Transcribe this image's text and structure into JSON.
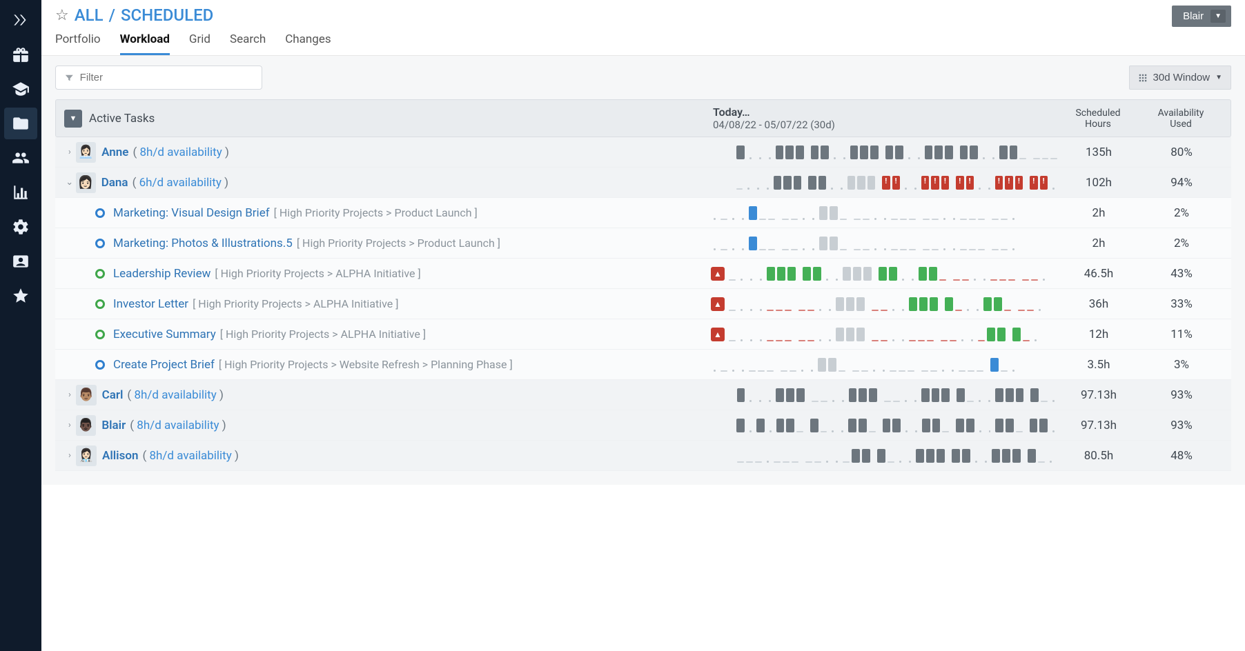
{
  "user": {
    "name": "Blair"
  },
  "breadcrumb": {
    "root": "ALL",
    "leaf": "SCHEDULED"
  },
  "tabs": [
    "Portfolio",
    "Workload",
    "Grid",
    "Search",
    "Changes"
  ],
  "activeTab": "Workload",
  "filter_placeholder": "Filter",
  "window_label": "30d Window",
  "header": {
    "tasks": "Active Tasks",
    "today": "Today…",
    "range": "04/08/22 - 05/07/22 (30d)",
    "hours_top": "Scheduled",
    "hours_bot": "Hours",
    "avail_top": "Availability",
    "avail_bot": "Used"
  },
  "people": [
    {
      "name": "Anne",
      "avail": "8h/d availability",
      "hours": "135h",
      "used": "80%",
      "expanded": false,
      "emoji": "👩🏻‍💼",
      "cells": "G . . . G G G G G . . G G G G G . . G G G G G . . G G _ _ _ _"
    },
    {
      "name": "Dana",
      "avail": "6h/d availability",
      "hours": "102h",
      "used": "94%",
      "expanded": true,
      "emoji": "👩🏻",
      "cells": "_ . . . G G G G G . . L L L R! R! . . R! R! R! R! R! . . R! R! R! R! R! .",
      "tasks": [
        {
          "name": "Marketing: Visual Design Brief",
          "path": "[ High Priority Projects > Product Launch ]",
          "color": "blue",
          "alert": false,
          "hours": "2h",
          "used": "2%",
          "cells": ": _ . . B _ _ _ _ . . L L _ _ _ . . _ _ _ _ _ . . _ _ _ _ _ ."
        },
        {
          "name": "Marketing: Photos & Illustrations.5",
          "path": "[ High Priority Projects > Product Launch ]",
          "color": "blue",
          "alert": false,
          "hours": "2h",
          "used": "2%",
          "cells": ": _ . . B _ _ _ _ . . L L _ _ _ . . _ _ _ _ _ . . _ _ _ _ _ ."
        },
        {
          "name": "Leadership Review",
          "path": "[ High Priority Projects > ALPHA Initiative ]",
          "color": "green",
          "alert": true,
          "hours": "46.5h",
          "used": "43%",
          "cells": "_ . . . N N N N N . . L L L N N . . N N r r r . . r r r r r ."
        },
        {
          "name": "Investor Letter",
          "path": "[ High Priority Projects > ALPHA Initiative ]",
          "color": "green",
          "alert": true,
          "hours": "36h",
          "used": "33%",
          "cells": "_ . . . r r r r r . . L L L r r . . N N N N r . . N N r r r ."
        },
        {
          "name": "Executive Summary",
          "path": "[ High Priority Projects > ALPHA Initiative ]",
          "color": "green",
          "alert": true,
          "hours": "12h",
          "used": "11%",
          "cells": "_ . . . r r r r r . . L L L r r . . r r r r r . . r N N N r ."
        },
        {
          "name": "Create Project Brief",
          "path": "[ High Priority Projects > Website Refresh > Planning Phase ]",
          "color": "blue",
          "alert": false,
          "hours": "3.5h",
          "used": "3%",
          "cells": ": _ . . _ _ _ _ _ . . L L _ _ _ . . _ _ _ _ _ . . _ _ _ B _ ."
        }
      ]
    },
    {
      "name": "Carl",
      "avail": "8h/d availability",
      "hours": "97.13h",
      "used": "93%",
      "expanded": false,
      "emoji": "👨🏽",
      "cells": "G . . . G G G _ _ . . G G G _ _ . . G G G G _ . . G G G G _ ."
    },
    {
      "name": "Blair",
      "avail": "8h/d availability",
      "hours": "97.13h",
      "used": "93%",
      "expanded": false,
      "emoji": "👨🏿",
      "cells": "G . G . G G _ G _ . . G G _ G G . . G G _ G G . . G G _ G G ."
    },
    {
      "name": "Allison",
      "avail": "8h/d availability",
      "hours": "80.5h",
      "used": "48%",
      "expanded": false,
      "emoji": "👩🏻‍⚕️",
      "cells": "_ _ _ . _ _ _ _ _ . . _ G G G _ . . G G G G G . . G G G G _ ."
    }
  ]
}
